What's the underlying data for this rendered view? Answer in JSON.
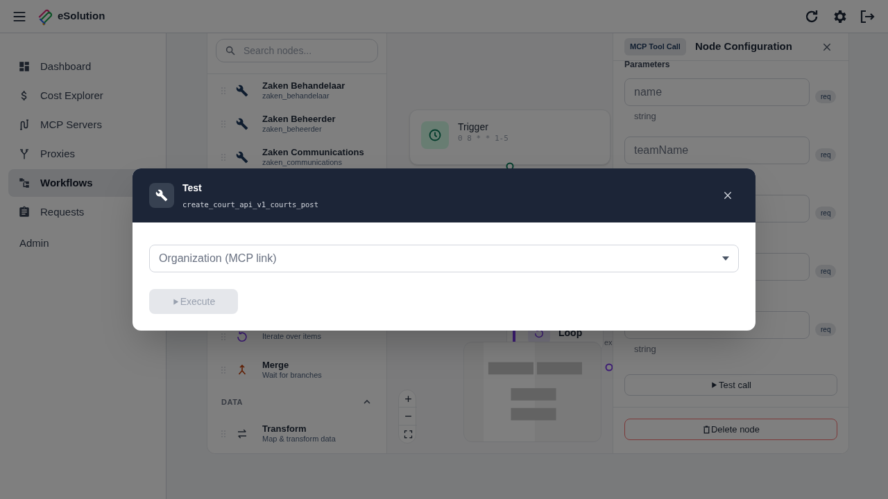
{
  "header": {
    "brand": "eSolution"
  },
  "sidebar": {
    "items": [
      {
        "label": "Dashboard",
        "selected": false
      },
      {
        "label": "Cost Explorer",
        "selected": false
      },
      {
        "label": "MCP Servers",
        "selected": false
      },
      {
        "label": "Proxies",
        "selected": false
      },
      {
        "label": "Workflows",
        "selected": true
      },
      {
        "label": "Requests",
        "selected": false
      }
    ],
    "section": "Admin"
  },
  "palette": {
    "search": {
      "placeholder": "Search nodes..."
    },
    "rows": [
      {
        "kind": "tool",
        "title": "Zaken Behandelaar",
        "subtitle": "zaken_behandelaar"
      },
      {
        "kind": "tool",
        "title": "Zaken Beheerder",
        "subtitle": "zaken_beheerder"
      },
      {
        "kind": "tool",
        "title": "Zaken Communications",
        "subtitle": "zaken_communications"
      },
      {
        "kind": "loop",
        "subtitle": "Iterate over items"
      },
      {
        "kind": "merge",
        "title": "Merge",
        "subtitle": "Wait for branches"
      },
      {
        "kind": "section",
        "label": "DATA",
        "expanded": true
      },
      {
        "kind": "transform",
        "title": "Transform",
        "subtitle": "Map & transform data"
      }
    ]
  },
  "canvas": {
    "trigger": {
      "title": "Trigger",
      "subtitle": "0 8 * * 1-5"
    },
    "loop": {
      "title": "Loop"
    },
    "side_text": "ex"
  },
  "config": {
    "badge": "MCP Tool Call",
    "title": "Node Configuration",
    "section": "Parameters",
    "params": [
      {
        "placeholder": "name",
        "hint": "string",
        "required": true,
        "required_label": "req"
      },
      {
        "placeholder": "teamName",
        "required": true,
        "required_label": "req"
      },
      {
        "required": true,
        "required_label": "req"
      },
      {
        "required": true,
        "required_label": "req"
      },
      {
        "required": true,
        "required_label": "req",
        "hint": "string"
      }
    ],
    "test_button": "Test call",
    "delete_button": "Delete node"
  },
  "modal": {
    "title": "Test",
    "subtitle": "create_court_api_v1_courts_post",
    "select": {
      "placeholder": "Organization (MCP link)"
    },
    "execute": {
      "label": "Execute",
      "disabled": true
    }
  }
}
